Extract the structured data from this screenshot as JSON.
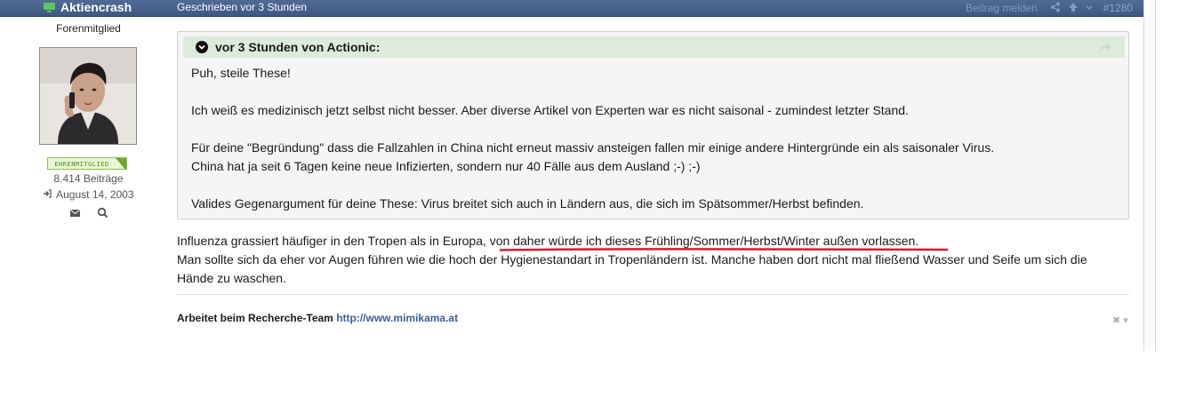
{
  "post": {
    "author": "Aktiencrash",
    "date": "Geschrieben vor 3 Stunden",
    "number": "#1280",
    "report_label": "Beitrag melden"
  },
  "user": {
    "title": "Forenmitglied",
    "rank_badge": "EHRENMITGLIED",
    "post_count": "8.414 Beiträge",
    "joined": "August 14, 2003"
  },
  "quote": {
    "header": "vor 3 Stunden von Actionic:",
    "lines": [
      "Puh, steile These!",
      "Ich weiß es medizinisch jetzt selbst nicht besser. Aber diverse Artikel von Experten war es nicht saisonal - zumindest letzter Stand.",
      "Für deine \"Begründung\" dass die Fallzahlen in China nicht erneut massiv ansteigen fallen mir einige andere Hintergründe ein als saisonaler Virus.",
      "China hat ja seit 6 Tagen keine neue Infizierten, sondern nur 40 Fälle aus dem Ausland ;-) ;-)",
      "Valides Gegenargument für deine These: Virus breitet sich auch in Ländern aus, die sich im Spätsommer/Herbst befinden."
    ]
  },
  "body": {
    "lines": [
      "Influenza grassiert häufiger in den Tropen als in Europa, von daher würde ich dieses Frühling/Sommer/Herbst/Winter außen vorlassen.",
      "Man sollte sich da eher vor Augen führen wie die hoch der Hygienestandart in Tropenländern ist. Manche haben dort nicht mal fließend Wasser und Seife um sich die",
      "Hände zu waschen."
    ]
  },
  "signature": {
    "text": "Arbeitet beim Recherche-Team",
    "link": "http://www.mimikama.at"
  },
  "colors": {
    "header_bar": "#3e5882",
    "quote_header": "#dcebdc",
    "link": "#3e5e9a",
    "annotation": "#d0021b"
  }
}
